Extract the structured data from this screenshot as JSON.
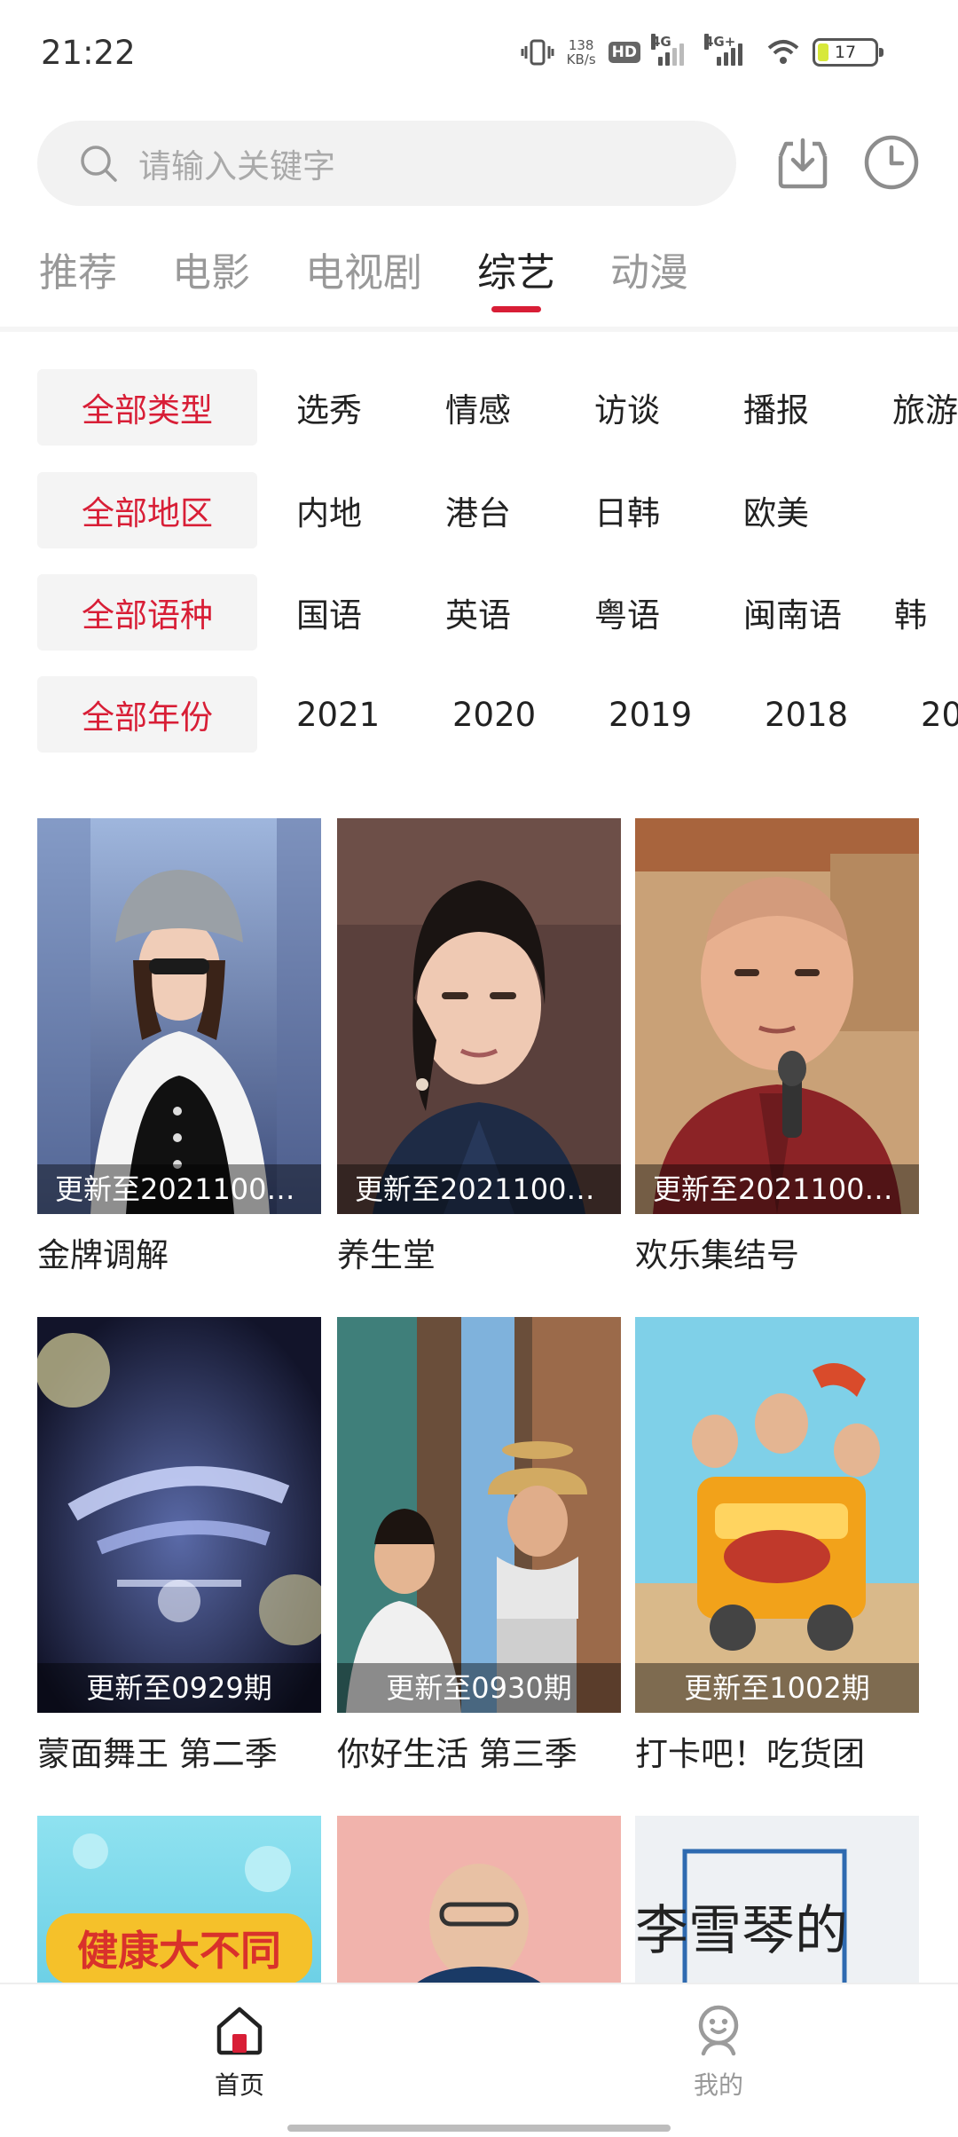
{
  "status_bar": {
    "time": "21:22",
    "net_speed_value": "138",
    "net_speed_unit": "KB/s",
    "hd_label": "HD",
    "signal1_label": "4G",
    "signal2_label": "4G+",
    "battery_level": "17",
    "battery_color": "#d7e83a"
  },
  "search": {
    "placeholder": "请输入关键字"
  },
  "tabs": [
    {
      "label": "推荐",
      "active": false
    },
    {
      "label": "电影",
      "active": false
    },
    {
      "label": "电视剧",
      "active": false
    },
    {
      "label": "综艺",
      "active": true
    },
    {
      "label": "动漫",
      "active": false
    }
  ],
  "filters": {
    "type": {
      "all": "全部类型",
      "options": [
        "选秀",
        "情感",
        "访谈",
        "播报",
        "旅游"
      ]
    },
    "region": {
      "all": "全部地区",
      "options": [
        "内地",
        "港台",
        "日韩",
        "欧美"
      ]
    },
    "language": {
      "all": "全部语种",
      "options": [
        "国语",
        "英语",
        "粤语",
        "闽南语",
        "韩"
      ]
    },
    "year": {
      "all": "全部年份",
      "options": [
        "2021",
        "2020",
        "2019",
        "2018",
        "20"
      ]
    }
  },
  "grid": [
    {
      "title": "金牌调解",
      "badge": "更新至2021100…"
    },
    {
      "title": "养生堂",
      "badge": "更新至2021100…"
    },
    {
      "title": "欢乐集结号",
      "badge": "更新至2021100…"
    },
    {
      "title": "蒙面舞王 第二季",
      "badge": "更新至0929期"
    },
    {
      "title": "你好生活 第三季",
      "badge": "更新至0930期"
    },
    {
      "title": "打卡吧！吃货团",
      "badge": "更新至1002期"
    },
    {
      "title": "",
      "badge": "",
      "poster_text": "健康大不同"
    },
    {
      "title": "",
      "badge": ""
    },
    {
      "title": "",
      "badge": "",
      "poster_text": "李雪琴的"
    }
  ],
  "bottom_nav": {
    "home": "首页",
    "mine": "我的"
  },
  "colors": {
    "accent": "#d81e36",
    "active_home": "#d81e36"
  }
}
